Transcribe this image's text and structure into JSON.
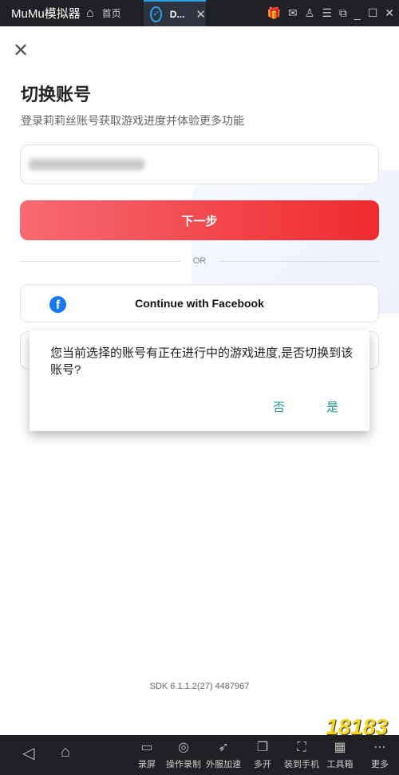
{
  "titlebar": {
    "app_name": "MuMu模拟器",
    "home_tab": "首页",
    "active_tab": "D...",
    "icons": [
      "gift-icon",
      "mail-icon",
      "user-icon",
      "menu-icon",
      "resize-icon",
      "minimize-icon",
      "maximize-icon",
      "close-icon"
    ]
  },
  "page": {
    "title": "切换账号",
    "subtitle": "登录莉莉丝账号获取游戏进度并体验更多功能",
    "next_label": "下一步",
    "or_label": "OR",
    "facebook_label": "Continue with Facebook",
    "sdk": "SDK 6.1.1.2(27) 4487967"
  },
  "dialog": {
    "message": "您当前选择的账号有正在进行中的游戏进度,是否切换到该账号?",
    "no": "否",
    "yes": "是",
    "accent": "#1f9b8e"
  },
  "bottombar": {
    "tools": [
      {
        "label": "录屏",
        "icon": "▭"
      },
      {
        "label": "操作录制",
        "icon": "◎"
      },
      {
        "label": "外服加速",
        "icon": "➶"
      },
      {
        "label": "多开",
        "icon": "❐"
      },
      {
        "label": "装到手机",
        "icon": "⛶"
      },
      {
        "label": "工具箱",
        "icon": "▦"
      },
      {
        "label": "更多",
        "icon": "⋯"
      }
    ]
  },
  "watermark": {
    "logo": "18183"
  }
}
